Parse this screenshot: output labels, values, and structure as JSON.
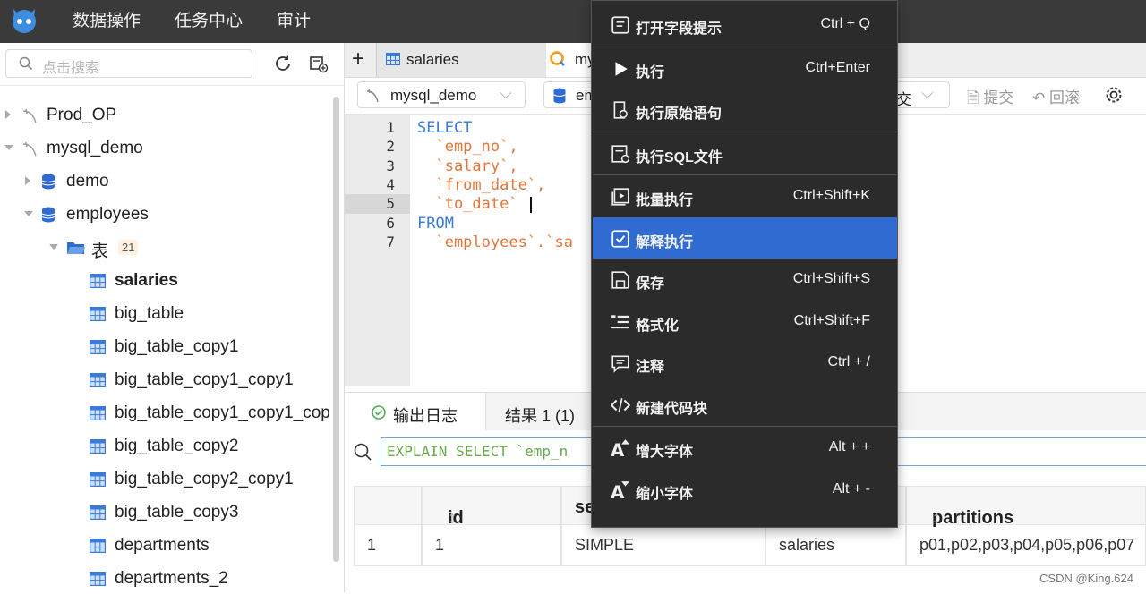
{
  "top_menu": [
    "数据操作",
    "任务中心",
    "审计"
  ],
  "sidebar": {
    "search_placeholder": "点击搜索",
    "tree": [
      {
        "label": "Prod_OP",
        "level": 0,
        "expanded": false,
        "icon": "mysql-icon"
      },
      {
        "label": "mysql_demo",
        "level": 0,
        "expanded": true,
        "icon": "mysql-icon"
      },
      {
        "label": "demo",
        "level": 1,
        "expanded": false,
        "icon": "database-icon"
      },
      {
        "label": "employees",
        "level": 1,
        "expanded": true,
        "icon": "database-icon"
      },
      {
        "label": "表",
        "level": 2,
        "expanded": true,
        "icon": "folder-icon",
        "badge": "21"
      },
      {
        "label": "salaries",
        "level": 3,
        "icon": "table-icon",
        "bold": true
      },
      {
        "label": "big_table",
        "level": 3,
        "icon": "table-icon"
      },
      {
        "label": "big_table_copy1",
        "level": 3,
        "icon": "table-icon"
      },
      {
        "label": "big_table_copy1_copy1",
        "level": 3,
        "icon": "table-icon"
      },
      {
        "label": "big_table_copy1_copy1_cop",
        "level": 3,
        "icon": "table-icon"
      },
      {
        "label": "big_table_copy2",
        "level": 3,
        "icon": "table-icon"
      },
      {
        "label": "big_table_copy2_copy1",
        "level": 3,
        "icon": "table-icon"
      },
      {
        "label": "big_table_copy3",
        "level": 3,
        "icon": "table-icon"
      },
      {
        "label": "departments",
        "level": 3,
        "icon": "table-icon"
      },
      {
        "label": "departments_2",
        "level": 3,
        "icon": "table-icon"
      }
    ]
  },
  "tabs": {
    "add": "+",
    "items": [
      "salaries",
      "my"
    ]
  },
  "toolbar": {
    "datasource": "mysql_demo",
    "db_partial": "em",
    "tx_partial": "交",
    "commit": "提交",
    "rollback": "回滚"
  },
  "editor": {
    "line_numbers": [
      "1",
      "2",
      "3",
      "4",
      "5",
      "6",
      "7"
    ],
    "lines": [
      {
        "t": "SELECT",
        "c": "kw"
      },
      {
        "t": "  `emp_no`,",
        "c": "id"
      },
      {
        "t": "  `salary`,",
        "c": "id"
      },
      {
        "t": "  `from_date`,",
        "c": "id"
      },
      {
        "t": "  `to_date`",
        "c": "id"
      },
      {
        "t": "FROM",
        "c": "kw"
      },
      {
        "t": "  `employees`.`sa",
        "c": "id"
      }
    ]
  },
  "results": {
    "tab_log": "输出日志",
    "tab_result": "结果 1 (1)",
    "explain_sql": "EXPLAIN SELECT `emp_n",
    "columns": [
      "",
      "id",
      "se",
      "",
      "partitions"
    ],
    "row": [
      "1",
      "1",
      "SIMPLE",
      "salaries",
      "p01,p02,p03,p04,p05,p06,p07"
    ]
  },
  "context_menu": [
    {
      "label": "打开字段提示",
      "shortcut": "Ctrl + Q",
      "icon": "field-hint-icon"
    },
    {
      "sep": true
    },
    {
      "label": "执行",
      "shortcut": "Ctrl+Enter",
      "icon": "play-icon"
    },
    {
      "label": "执行原始语句",
      "shortcut": "",
      "icon": "raw-exec-icon"
    },
    {
      "sep": true
    },
    {
      "label": "执行SQL文件",
      "shortcut": "",
      "icon": "sql-file-icon"
    },
    {
      "sep": true
    },
    {
      "label": "批量执行",
      "shortcut": "Ctrl+Shift+K",
      "icon": "batch-exec-icon"
    },
    {
      "label": "解释执行",
      "shortcut": "",
      "icon": "explain-icon",
      "active": true
    },
    {
      "label": "保存",
      "shortcut": "Ctrl+Shift+S",
      "icon": "save-icon"
    },
    {
      "label": "格式化",
      "shortcut": "Ctrl+Shift+F",
      "icon": "format-icon"
    },
    {
      "label": "注释",
      "shortcut": "Ctrl + /",
      "icon": "comment-icon"
    },
    {
      "label": "新建代码块",
      "shortcut": "",
      "icon": "code-block-icon"
    },
    {
      "sep": true
    },
    {
      "label": "增大字体",
      "shortcut": "Alt + +",
      "icon": "font-increase-icon"
    },
    {
      "label": "缩小字体",
      "shortcut": "Alt + -",
      "icon": "font-decrease-icon"
    }
  ],
  "watermark": "CSDN @King.624",
  "colors": {
    "topbar": "#3a3a3a",
    "menu_bg": "#2b2b2b",
    "menu_active": "#2f6bd0",
    "keyword": "#3b7bd8",
    "identifier": "#e0763c"
  }
}
